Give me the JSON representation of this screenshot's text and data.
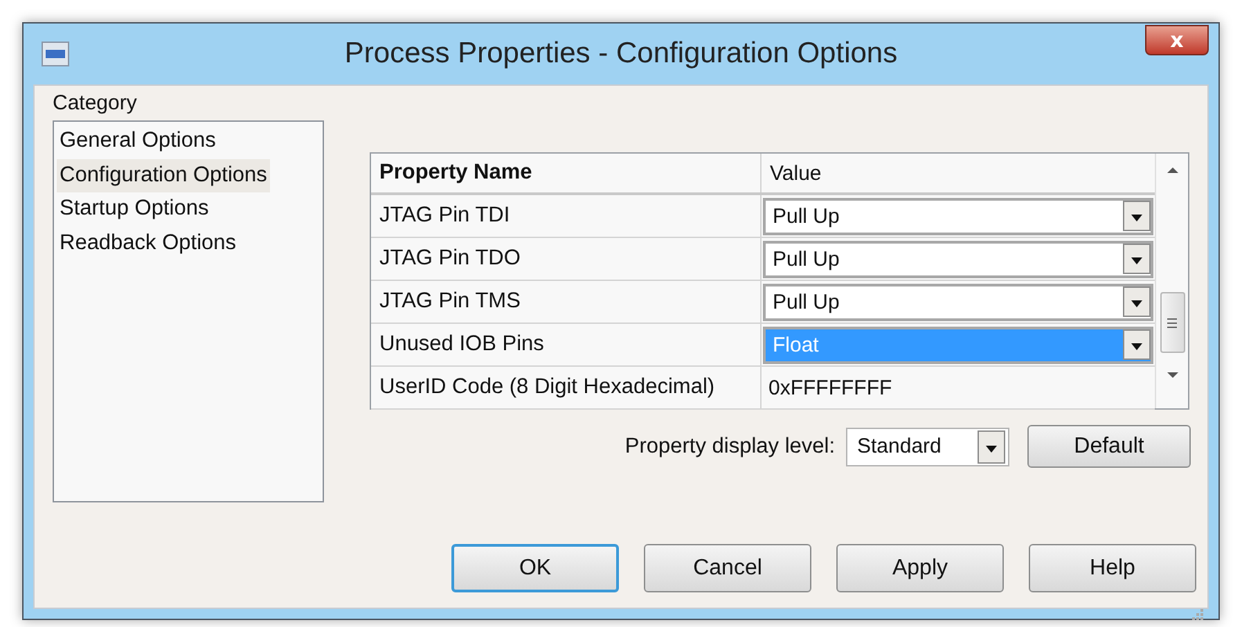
{
  "window": {
    "title": "Process Properties - Configuration Options",
    "close": "x"
  },
  "category": {
    "label": "Category",
    "items": [
      {
        "label": "General Options",
        "selected": false
      },
      {
        "label": "Configuration Options",
        "selected": true
      },
      {
        "label": "Startup Options",
        "selected": false
      },
      {
        "label": "Readback Options",
        "selected": false
      }
    ]
  },
  "table": {
    "columns": [
      "Property Name",
      "Value"
    ],
    "rows": [
      {
        "name": "JTAG Pin TDI",
        "value": "Pull Up",
        "kind": "dropdown",
        "selected": false
      },
      {
        "name": "JTAG Pin TDO",
        "value": "Pull Up",
        "kind": "dropdown",
        "selected": false
      },
      {
        "name": "JTAG Pin TMS",
        "value": "Pull Up",
        "kind": "dropdown",
        "selected": false
      },
      {
        "name": "Unused IOB Pins",
        "value": "Float",
        "kind": "dropdown",
        "selected": true
      },
      {
        "name": "UserID Code (8 Digit Hexadecimal)",
        "value": "0xFFFFFFFF",
        "kind": "text",
        "selected": false
      }
    ]
  },
  "display_level": {
    "label": "Property display level:",
    "value": "Standard"
  },
  "default_button": "Default",
  "buttons": [
    {
      "label": "OK",
      "default": true
    },
    {
      "label": "Cancel",
      "default": false
    },
    {
      "label": "Apply",
      "default": false
    },
    {
      "label": "Help",
      "default": false
    }
  ]
}
